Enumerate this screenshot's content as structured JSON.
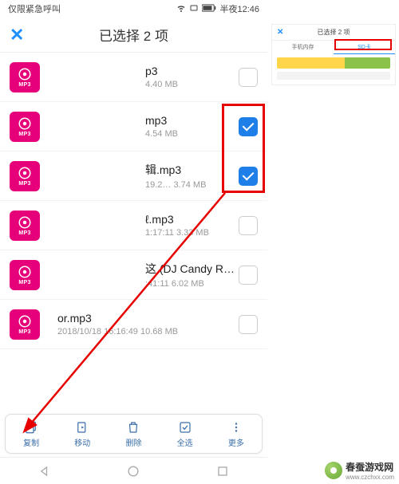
{
  "statusbar": {
    "left": "仅限紧急呼叫",
    "time": "半夜12:46"
  },
  "header": {
    "title": "已选择 2 项"
  },
  "thumb_tag": "MP3",
  "files": [
    {
      "name": "p3",
      "meta": "4.40 MB",
      "checked": false
    },
    {
      "name": "mp3",
      "meta": "4.54 MB",
      "checked": true
    },
    {
      "name": "辑.mp3",
      "meta": "19.2… 3.74 MB",
      "checked": true
    },
    {
      "name": "ℓ.mp3",
      "meta": "1:17:11 3.33 MB",
      "checked": false
    },
    {
      "name": "这 (DJ Candy Remix).m…",
      "meta": ":41:11 6.02 MB",
      "checked": false
    },
    {
      "name": "or.mp3",
      "meta": "2018/10/18 16:16:49 10.68 MB",
      "checked": false
    }
  ],
  "actions": {
    "copy": "复制",
    "move": "移动",
    "delete": "删除",
    "selectall": "全选",
    "more": "更多"
  },
  "mini": {
    "title": "已选择 2 项",
    "tab1": "手机内存",
    "tab2": "SD卡"
  },
  "watermark": {
    "name": "春蚕游戏网",
    "url": "www.czchxx.com"
  }
}
